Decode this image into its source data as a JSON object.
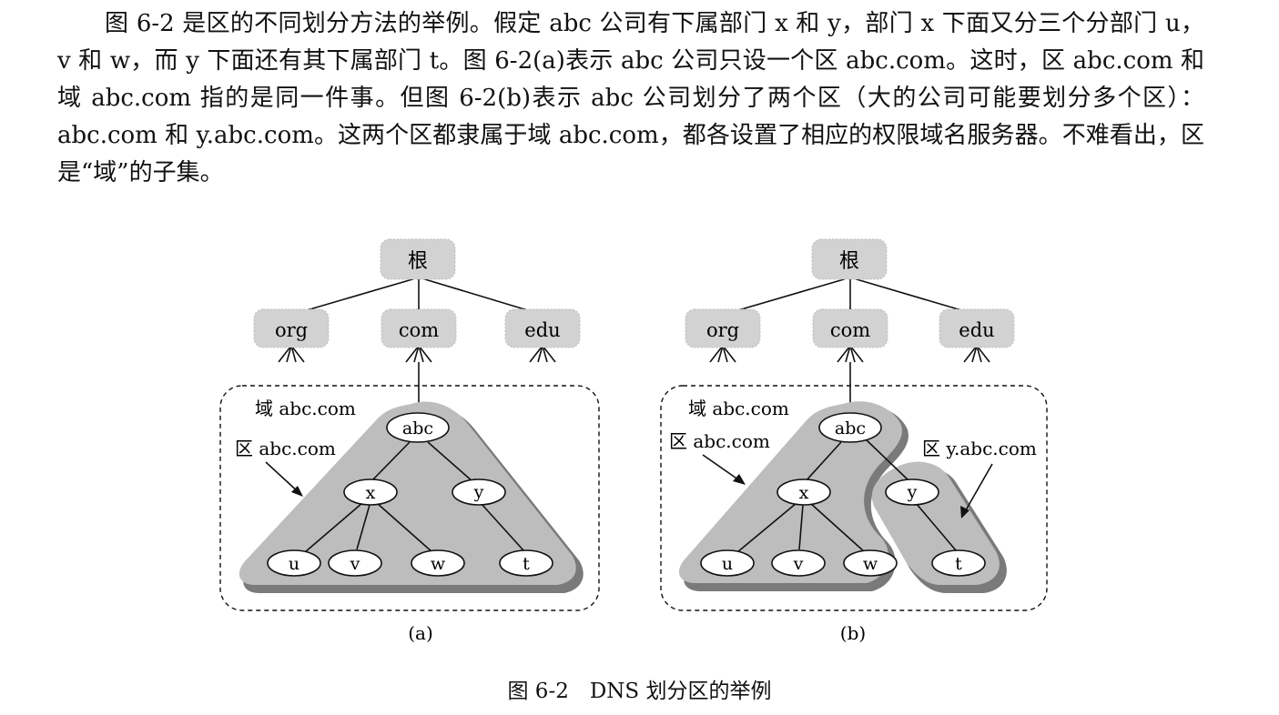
{
  "paragraph": "图 6-2 是区的不同划分方法的举例。假定 abc 公司有下属部门 x 和 y，部门 x 下面又分三个分部门 u，v 和 w，而 y 下面还有其下属部门 t。图 6-2(a)表示 abc 公司只设一个区 abc.com。这时，区 abc.com 和域 abc.com 指的是同一件事。但图 6-2(b)表示 abc 公司划分了两个区（大的公司可能要划分多个区）：abc.com 和 y.abc.com。这两个区都隶属于域 abc.com，都各设置了相应的权限域名服务器。不难看出，区是“域”的子集。",
  "figure": {
    "caption": "图 6-2　DNS 划分区的举例",
    "panel_a": {
      "label": "(a)",
      "root": "根",
      "tld": [
        "org",
        "com",
        "edu"
      ],
      "domain_label": "域 abc.com",
      "zone_label": "区 abc.com",
      "nodes": {
        "abc": "abc",
        "x": "x",
        "y": "y",
        "u": "u",
        "v": "v",
        "w": "w",
        "t": "t"
      }
    },
    "panel_b": {
      "label": "(b)",
      "root": "根",
      "tld": [
        "org",
        "com",
        "edu"
      ],
      "domain_label": "域 abc.com",
      "zone1_label": "区 abc.com",
      "zone2_label": "区 y.abc.com",
      "nodes": {
        "abc": "abc",
        "x": "x",
        "y": "y",
        "u": "u",
        "v": "v",
        "w": "w",
        "t": "t"
      }
    }
  },
  "colors": {
    "zone_fill": "#bdbdbd",
    "zone_shadow": "#7a7a7a",
    "box_fill": "#d2d2d2",
    "ink": "#111111"
  }
}
